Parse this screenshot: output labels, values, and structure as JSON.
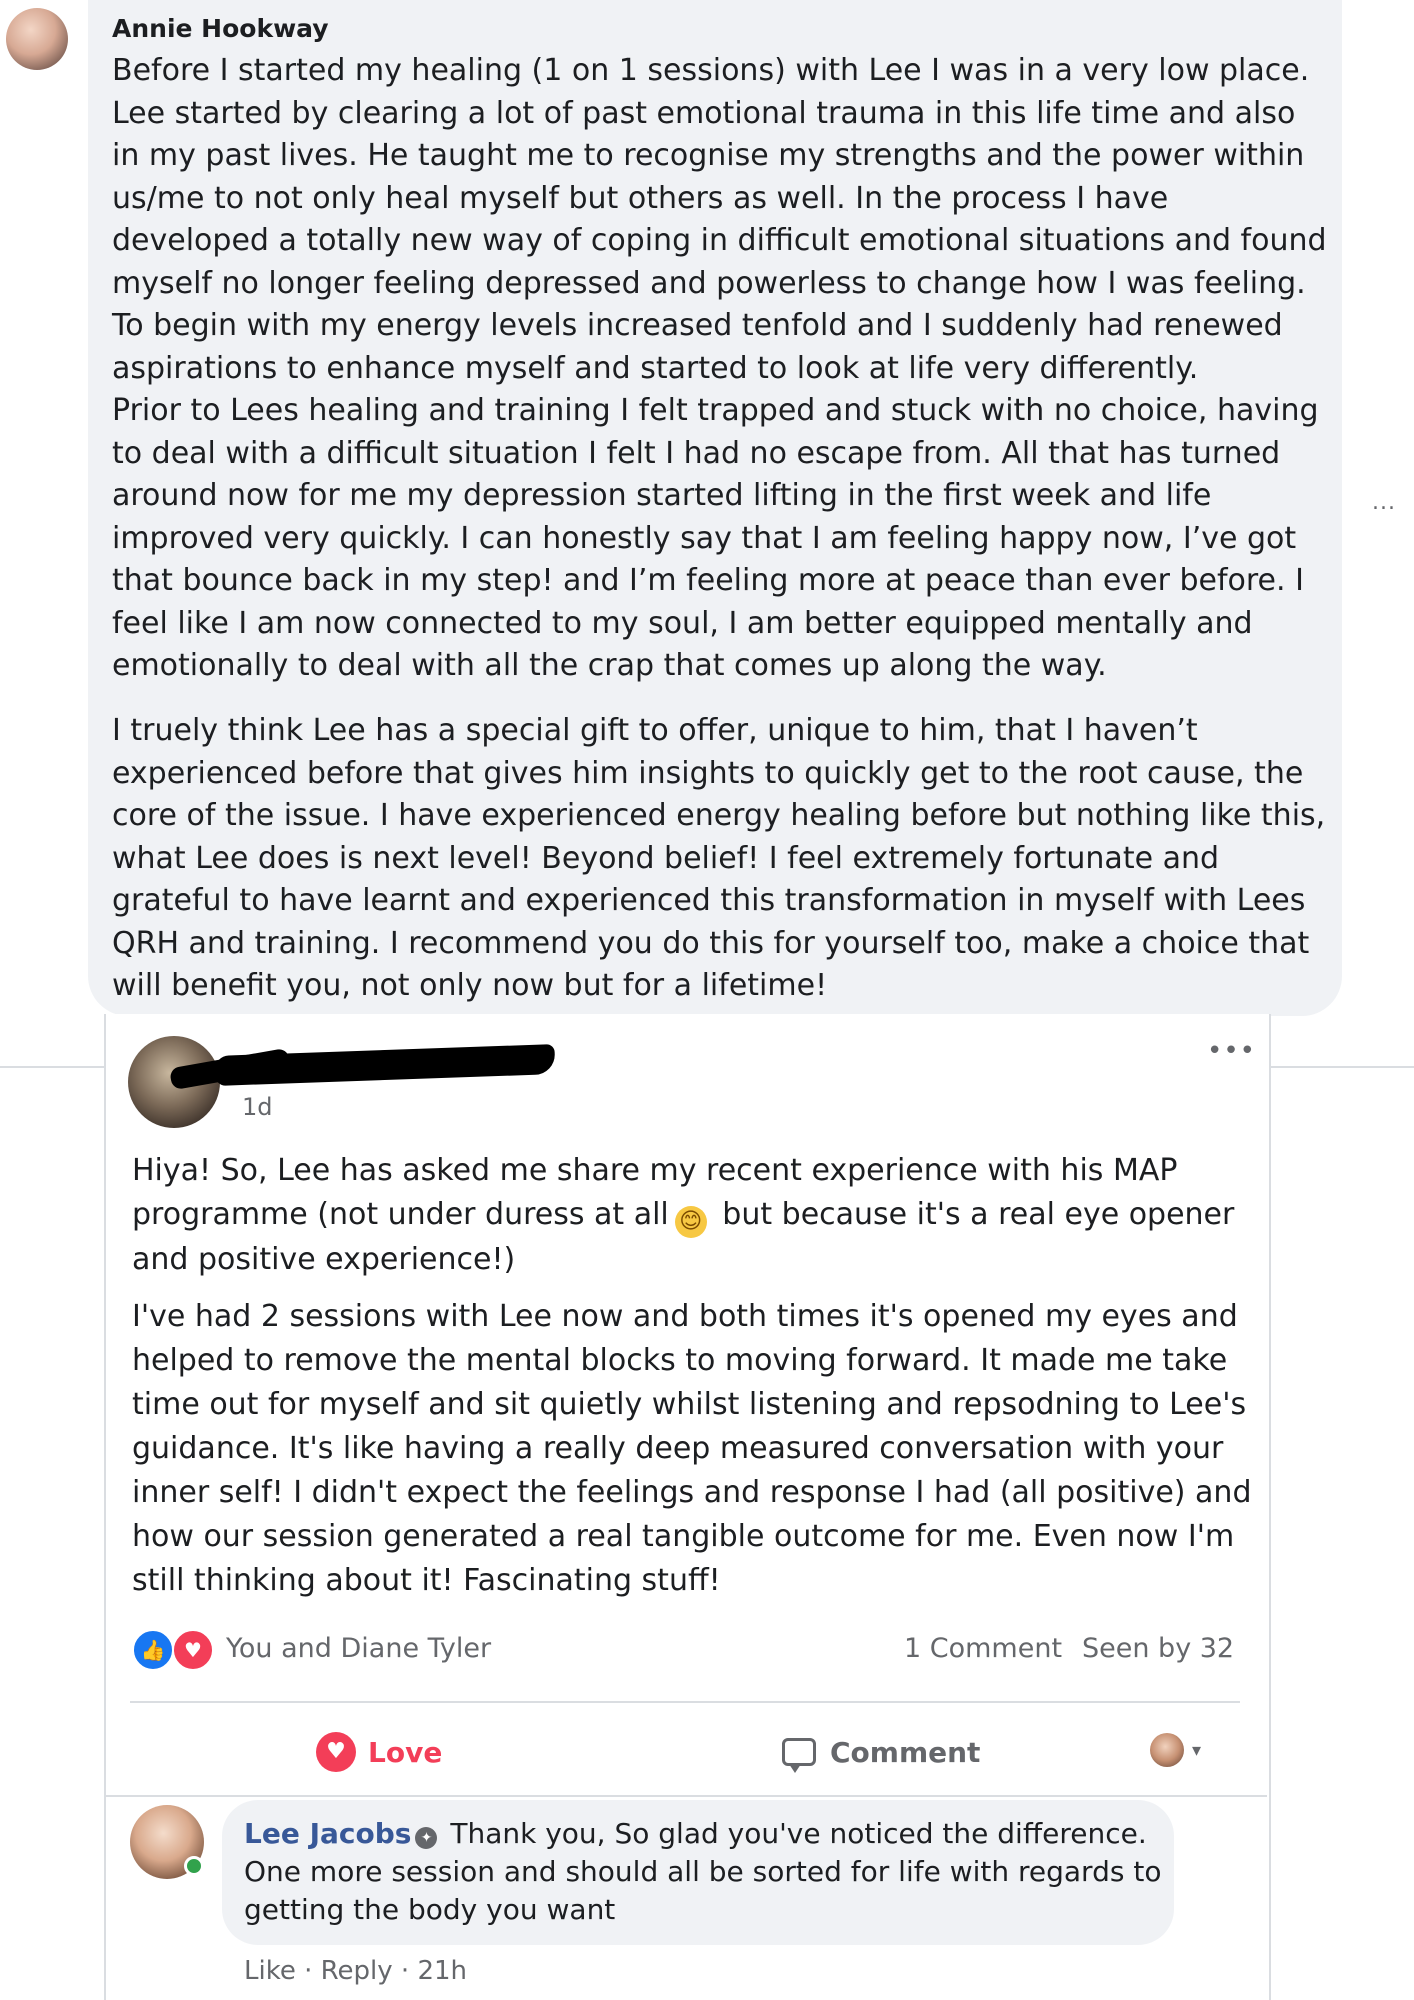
{
  "top_comment": {
    "author": "Annie Hookway",
    "paragraph1": "Before I started my healing (1 on 1 sessions) with Lee I was in a very low place. Lee started by clearing a lot of past emotional trauma in this life time and also in my past lives. He taught me to recognise my strengths and the power within us/me to not only heal myself but others as well. In the process I have developed a totally new way of coping in difficult emotional situations and found myself no longer feeling depressed and powerless to change how I was feeling.\nTo begin with my energy levels increased tenfold and I suddenly had renewed aspirations to enhance myself and started to look at life very differently.\nPrior to Lees healing and training I felt trapped and stuck with no choice, having to deal with a difficult situation I felt I had no escape from. All that has turned around now for me my depression started lifting in the first week and life improved very quickly. I can honestly say that I am feeling happy now, I’ve got that bounce back in my step! and I’m feeling more at peace than ever before. I feel like I am now connected to my soul, I am better equipped mentally and emotionally to deal with all the crap that comes up along the way.",
    "paragraph2": "I truely think Lee has a special gift to offer, unique to him, that I haven’t experienced before that gives him insights to quickly get to the root cause, the core of the issue. I have experienced energy healing before but nothing like this, what Lee does is next level! Beyond belief! I feel extremely fortunate and grateful to have learnt and experienced this transformation in myself with Lees QRH and training. I recommend you do this for yourself too, make a choice that will benefit you, not only now but for a lifetime!",
    "more_glyph": "..."
  },
  "post": {
    "time": "1d",
    "more_glyph": "•••",
    "para1_before_emoji": "Hiya! So, Lee has asked me share my recent experience with his MAP programme (not under duress at all",
    "emoji": "😊",
    "para1_after_emoji": " but because it's a real eye opener and positive experience!)",
    "paragraph2": "I've had 2 sessions with Lee now and both times it's opened my eyes and helped to remove the mental blocks to moving forward. It made me take time out for myself and sit quietly whilst listening and repsodning to Lee's guidance. It's like having a really deep measured conversation with your inner self! I didn't expect the feelings and response I had (all positive) and how our session generated a real tangible outcome for me. Even now I'm still thinking about it! Fascinating stuff!",
    "reactions": {
      "names": "You and Diane Tyler",
      "comment_count": "1 Comment",
      "seen_by": "Seen by 32",
      "like_glyph": "👍",
      "love_glyph": "♥"
    },
    "actions": {
      "love_label": "Love",
      "comment_label": "Comment",
      "heart_glyph": "♥",
      "caret_glyph": "▾"
    }
  },
  "reply": {
    "author": "Lee Jacobs",
    "badge_glyph": "✦",
    "text": "Thank you, So glad you've noticed the difference. One more session and should all be sorted for life with regards to getting the body you want",
    "like_label": "Like",
    "reply_label": "Reply",
    "time": "21h",
    "separator": " · "
  },
  "colors": {
    "bubble_bg": "#f0f2f5",
    "text": "#1c1e21",
    "secondary": "#65676b",
    "love": "#f33e58",
    "like": "#1877f2",
    "link_author": "#385898",
    "online": "#31a24c"
  }
}
